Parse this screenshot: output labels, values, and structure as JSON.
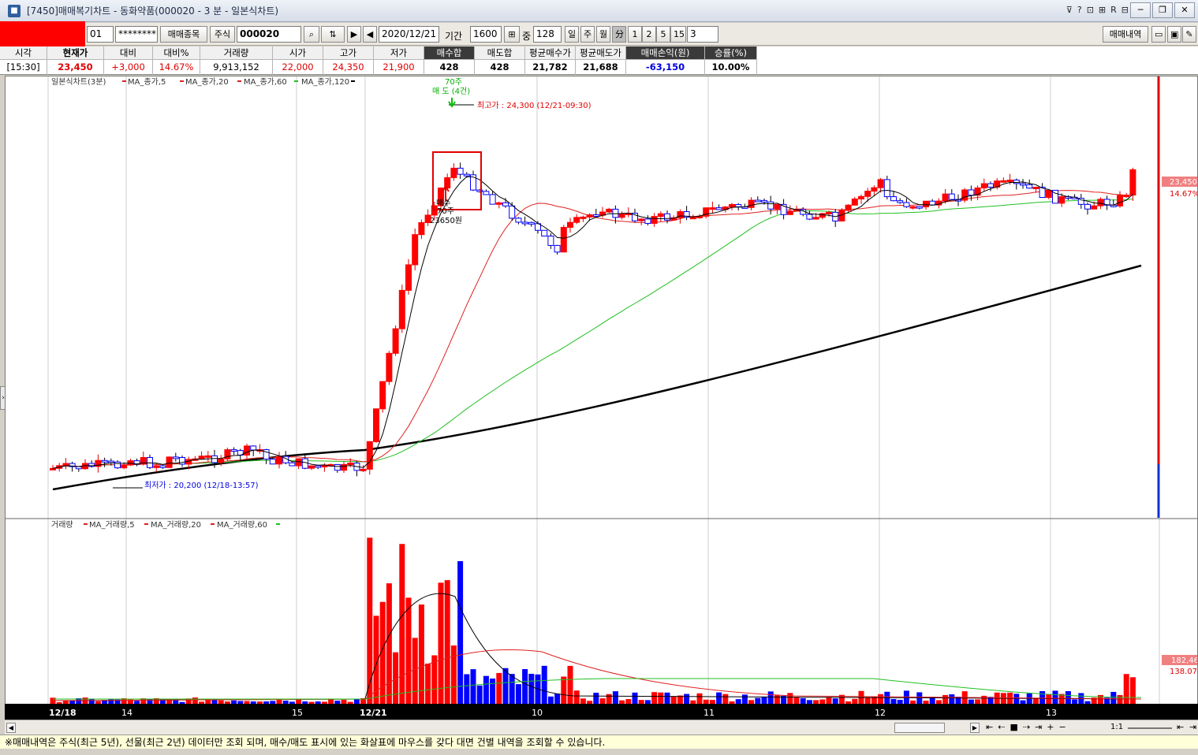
{
  "window": {
    "title": "[7450]매매복기차트 - 동화약품(000020 - 3 분 - 일본식차트)"
  },
  "toolbar": {
    "account_suffix": "01",
    "password": "********",
    "trade_stock_button": "매매종목",
    "stock_label": "주식",
    "stock_code": "000020",
    "date": "2020/12/21",
    "period_label": "기간",
    "period_value": "1600",
    "middle_label": "중",
    "middle_value": "128",
    "unit_day": "일",
    "unit_week": "주",
    "unit_month": "월",
    "unit_min": "分",
    "ticks": [
      "1",
      "2",
      "5",
      "15"
    ],
    "interval_value": "3",
    "trade_history_button": "매매내역"
  },
  "info": {
    "headers": [
      "시각",
      "현재가",
      "대비",
      "대비%",
      "거래량",
      "시가",
      "고가",
      "저가",
      "매수합",
      "매도합",
      "평균매수가",
      "평균매도가",
      "매매손익(원)",
      "승률(%)"
    ],
    "values": [
      "[15:30]",
      "23,450",
      "+3,000",
      "14.67%",
      "9,913,152",
      "22,000",
      "24,350",
      "21,900",
      "428",
      "428",
      "21,782",
      "21,688",
      "-63,150",
      "10.00%"
    ]
  },
  "price_panel": {
    "legend_title": "일본식차트(3분)",
    "legend_items": [
      "MA_종가,5",
      "MA_종가,20",
      "MA_종가,60",
      "MA_종가,120"
    ],
    "high_annotation": "최고가 : 24,300 (12/21-09:30)",
    "low_annotation": "최저가 : 20,200 (12/18-13:57)",
    "sell_marker_qty": "70주",
    "sell_marker_label": "매 도 (4건)",
    "buy_marker_label": "매수",
    "buy_marker_qty": "70주",
    "buy_marker_price": "23650원",
    "price_tag": "23,450",
    "pct_tag": "14.67%"
  },
  "volume_panel": {
    "legend_title": "거래량",
    "legend_items": [
      "MA_거래량,5",
      "MA_거래량,20",
      "MA_거래량,60"
    ],
    "vol_tag": "182,46",
    "pct_tag": "138.07%"
  },
  "x_axis": {
    "labels": [
      "12/18",
      "14",
      "15",
      "12/21",
      "10",
      "11",
      "12",
      "13"
    ]
  },
  "scroll": {
    "ratio": "1:1"
  },
  "status": {
    "message": "※매매내역은 주식(최근 5년), 선물(최근 2년) 데이터만 조회 되며, 매수/매도 표시에 있는 화살표에 마우스를 갖다 대면 건별 내역을 조회할 수 있습니다."
  },
  "colors": {
    "up": "#ff0000",
    "down": "#0000ff",
    "ma5": "#000000",
    "ma20": "#e02020",
    "ma60": "#20c020",
    "ma120": "#000000"
  }
}
